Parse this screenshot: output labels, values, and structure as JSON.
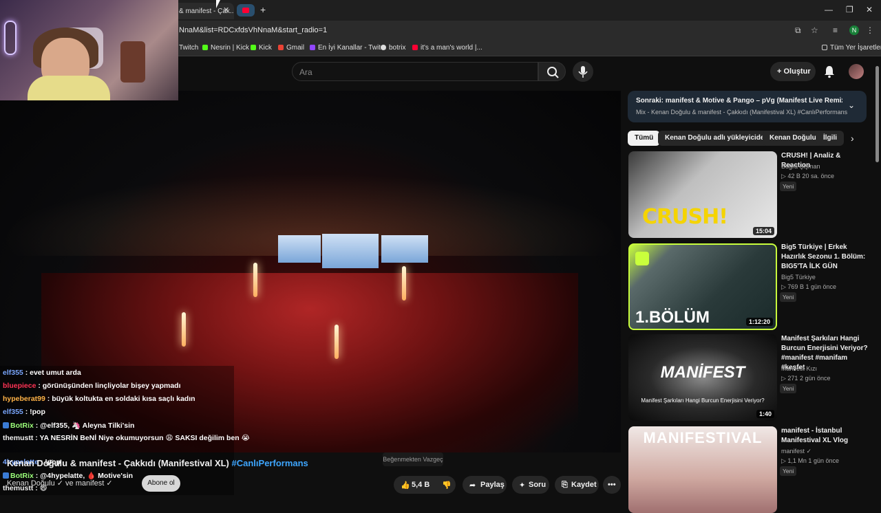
{
  "browser": {
    "active_tab_title": "& manifest - Çak...",
    "url": "NnaM&list=RDCxfdsVhNnaM&start_radio=1",
    "profile_initial": "N",
    "bookmarks": [
      {
        "label": "Twitch",
        "color": "#9146ff"
      },
      {
        "label": "Nesrin | Kick",
        "color": "#53fc18"
      },
      {
        "label": "Kick",
        "color": "#53fc18"
      },
      {
        "label": "Gmail",
        "color": "#ea4335"
      },
      {
        "label": "En İyi Kanallar - Twit...",
        "color": "#9146ff"
      },
      {
        "label": "botrix",
        "color": "#dddddd"
      },
      {
        "label": "it's a man's world |...",
        "color": "#ff0033"
      }
    ],
    "all_bookmarks_label": "Tüm Yer İşaretleri"
  },
  "youtube": {
    "search_placeholder": "Ara",
    "create_label": "Oluştur",
    "video": {
      "title": "Kenan Doğulu & manifest - Çakkıdı (Manifestival XL)",
      "hashtag": "#CanlıPerformans",
      "channel": "Kenan Doğulu ✓ ve manifest ✓",
      "subscribe_label": "Abone ol",
      "dislike_tooltip": "Beğenmekten Vazgeç",
      "likes": "5,4 B",
      "share_label": "Paylaş",
      "ask_label": "Soru",
      "save_label": "Kaydet"
    },
    "next_up": {
      "title": "Sonraki: manifest & Motive & Pango – pVg (Manifest Live Remix) | Offi...",
      "subtitle": "Mix - Kenan Doğulu & manifest - Çakkıdı (Manifestival XL) #CanlıPerformans"
    },
    "chips": [
      "Tümü",
      "Kenan Doğulu adlı yükleyiciden",
      "Kenan Doğulu",
      "İlgili"
    ],
    "cards": [
      {
        "title": "CRUSH! | Analiz & Reaction",
        "channel": "Buğra Şişman",
        "meta": "▷ 42 B  20 sa. önce",
        "badge": "Yeni",
        "duration": "15:04",
        "thumb_text": "CRUSH!"
      },
      {
        "title": "Big5 Türkiye | Erkek Hazırlık Sezonu 1. Bölüm: BIG5'TA İLK GÜN",
        "channel": "Big5 Türkiye",
        "meta": "▷ 769 B  1 gün önce",
        "badge": "Yeni",
        "duration": "1:12:20",
        "thumb_text": "1.BÖLÜM"
      },
      {
        "title": "Manifest Şarkıları Hangi Burcun Enerjisini Veriyor? #manifest #manifam #keşfet",
        "channel": "Manifest Kızı",
        "meta": "▷ 271  2 gün önce",
        "badge": "Yeni",
        "duration": "1:40",
        "thumb_text": "MANİFEST",
        "thumb_sub": "Manifest Şarkıları Hangi Burcun Enerjisini Veriyor?"
      },
      {
        "title": "manifest - İstanbul Manifestival XL Vlog",
        "channel": "manifest ✓",
        "meta": "▷ 1,1 Mn  1 gün önce",
        "badge": "Yeni",
        "duration": "",
        "thumb_text": "MANIFESTIVAL"
      }
    ]
  },
  "chat": [
    {
      "user": "elf355",
      "text": ": evet umut arda",
      "cls": "u1"
    },
    {
      "user": "bluepiece",
      "text": ": görünüşünden linçliyolar bişey yapmadı",
      "cls": "u2"
    },
    {
      "user": "hypeberat99",
      "text": ": büyük koltukta en soldaki kısa saçlı kadın",
      "cls": "u3"
    },
    {
      "user": "elf355",
      "text": ": !pop",
      "cls": "u1"
    },
    {
      "user": "BotRix",
      "text": ": @elf355, 🦄 Aleyna Tilki'sin",
      "cls": "u4"
    },
    {
      "user": "themustt",
      "text": ": YA NESRİN BeNİ Niye okumuyorsun 😩 SAKSI değilim ben 😭",
      "cls": "u5"
    },
    {
      "user": "4hypelatte",
      "text": ": !pop",
      "cls": "u1"
    },
    {
      "user": "BotRix",
      "text": ": @4hypelatte, 🩸 Motive'sin",
      "cls": "u4"
    },
    {
      "user": "themustt",
      "text": ": 😄",
      "cls": "u5"
    }
  ]
}
